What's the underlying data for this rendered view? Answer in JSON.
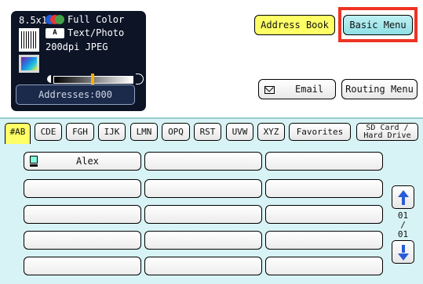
{
  "status": {
    "paper_size": "8.5x11",
    "color_mode": "Full Color",
    "original_type": "Text/Photo",
    "resolution": "200dpi JPEG",
    "textphoto_icon_label": "A",
    "density_level_fraction": 0.5,
    "addresses": "Addresses:000",
    "colors": {
      "red": "#e53935",
      "green": "#43a047",
      "blue": "#1e5bd8"
    }
  },
  "toolbar": {
    "address_book": "Address Book",
    "basic_menu": "Basic Menu",
    "email": "Email",
    "routing_menu": "Routing Menu"
  },
  "tabs": [
    "#AB",
    "CDE",
    "FGH",
    "IJK",
    "LMN",
    "OPQ",
    "RST",
    "UVW",
    "XYZ",
    "Favorites"
  ],
  "tab_sd_card": [
    "SD Card /",
    "Hard Drive"
  ],
  "active_tab": "#AB",
  "addresses": {
    "first_entry": "Alex",
    "first_entry_icon": "pc-icon"
  },
  "pager": {
    "current": "01",
    "separator": "/",
    "total": "01"
  },
  "theme": {
    "accent_yellow": "#ffff66",
    "highlight_red": "#ee3322",
    "panel_dark": "#0c1426",
    "background_cyan": "#d8f3f5"
  }
}
